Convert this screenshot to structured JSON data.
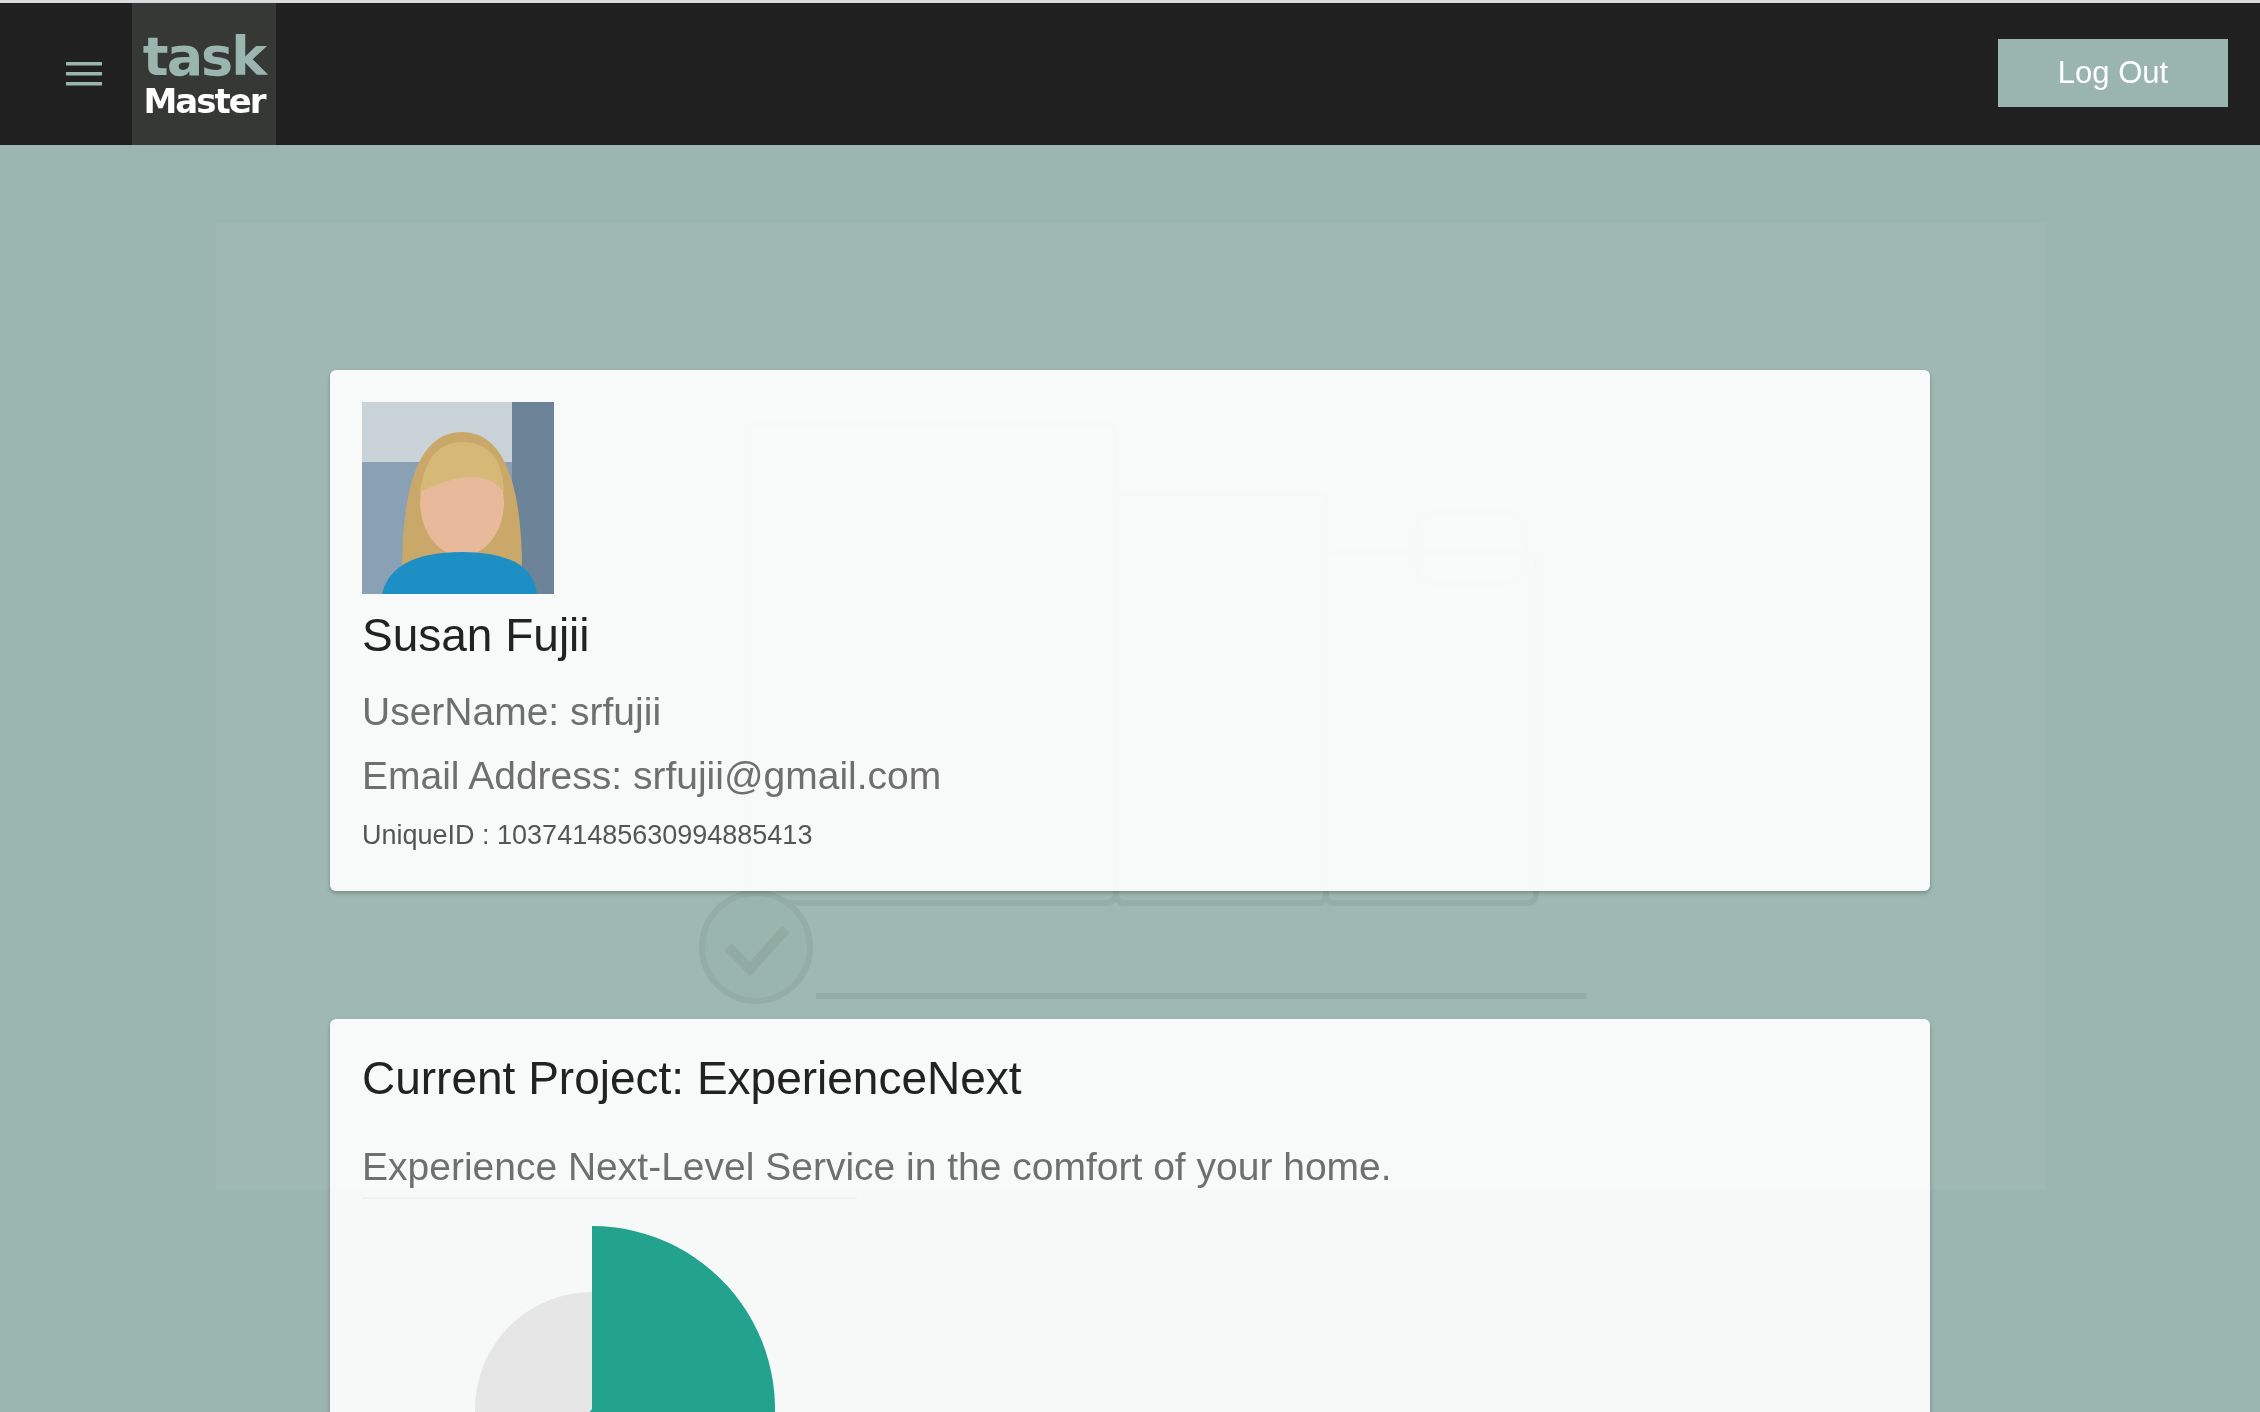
{
  "header": {
    "logo": {
      "top": "task",
      "bottom": "Master"
    },
    "logout_button": "Log Out"
  },
  "profile": {
    "name": "Susan Fujii",
    "username": "UserName: srfujii",
    "email": "Email Address: srfujii@gmail.com",
    "unique_id": "UniqueID : 103741485630994885413"
  },
  "project": {
    "title": "Current Project: ExperienceNext",
    "description": "Experience Next-Level Service in the comfort of your home."
  }
}
